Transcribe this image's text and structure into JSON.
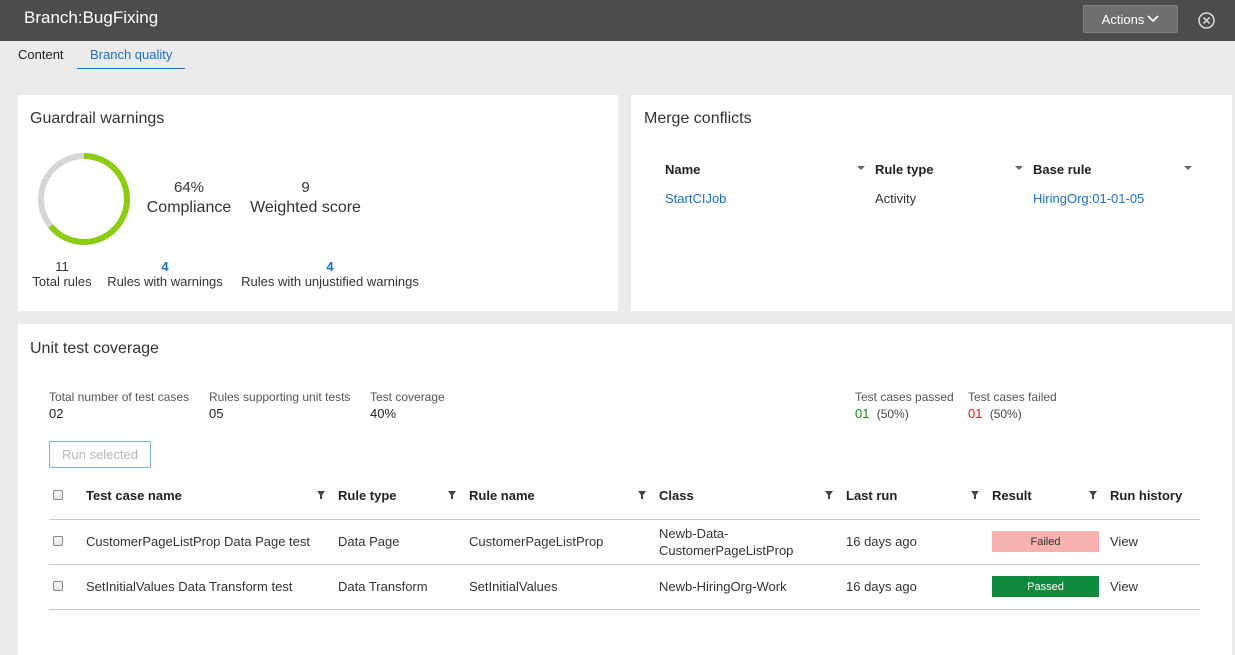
{
  "header": {
    "title": "Branch:BugFixing",
    "actions_label": "Actions"
  },
  "tabs": [
    {
      "label": "Content",
      "active": false
    },
    {
      "label": "Branch quality",
      "active": true
    }
  ],
  "guardrail": {
    "title": "Guardrail warnings",
    "compliance_value": "64%",
    "compliance_fraction": 0.64,
    "compliance_label": "Compliance",
    "weighted_value": "9",
    "weighted_label": "Weighted score",
    "total_rules_value": "11",
    "total_rules_label": "Total rules",
    "rules_with_warnings_value": "4",
    "rules_with_warnings_label": "Rules with warnings",
    "unjustified_value": "4",
    "unjustified_label": "Rules with unjustified warnings",
    "colors": {
      "ring": "#8ccc12",
      "track": "#d6d6d6"
    }
  },
  "merge_conflicts": {
    "title": "Merge conflicts",
    "columns": [
      "Name",
      "Rule type",
      "Base rule"
    ],
    "rows": [
      {
        "name": "StartCIJob",
        "rule_type": "Activity",
        "base_rule": "HiringOrg:01-01-05"
      }
    ]
  },
  "unit_test": {
    "title": "Unit test coverage",
    "summary": {
      "total_cases_label": "Total number of test cases",
      "total_cases_value": "02",
      "rules_supporting_label": "Rules supporting unit tests",
      "rules_supporting_value": "05",
      "coverage_label": "Test coverage",
      "coverage_value": "40%",
      "passed_label": "Test cases passed",
      "passed_count": "01",
      "passed_pct": "(50%)",
      "failed_label": "Test cases failed",
      "failed_count": "01",
      "failed_pct": "(50%)"
    },
    "run_selected_label": "Run selected",
    "columns": [
      "Test case name",
      "Rule type",
      "Rule name",
      "Class",
      "Last run",
      "Result",
      "Run history"
    ],
    "rows": [
      {
        "test_case": "CustomerPageListProp Data Page test",
        "rule_type": "Data Page",
        "rule_name": "CustomerPageListProp",
        "class_line1": "Newb-Data-",
        "class_line2": "CustomerPageListProp",
        "last_run": "16 days ago",
        "result": "Failed",
        "history": "View"
      },
      {
        "test_case": "SetInitialValues Data Transform test",
        "rule_type": "Data Transform",
        "rule_name": "SetInitialValues",
        "class_line1": "Newb-HiringOrg-Work",
        "class_line2": "",
        "last_run": "16 days ago",
        "result": "Passed",
        "history": "View"
      }
    ],
    "colors": {
      "failed": "#f7b1ae",
      "passed": "#0f8a3c"
    }
  }
}
